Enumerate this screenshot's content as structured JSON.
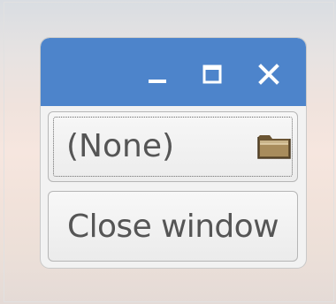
{
  "window": {
    "titlebar_color": "#4d84cb",
    "controls": [
      {
        "name": "minimize",
        "icon": "minimize-icon"
      },
      {
        "name": "maximize",
        "icon": "maximize-icon"
      },
      {
        "name": "close",
        "icon": "close-icon"
      }
    ]
  },
  "file_chooser": {
    "value": "(None)",
    "icon": "folder-icon"
  },
  "close_button": {
    "label": "Close window"
  }
}
